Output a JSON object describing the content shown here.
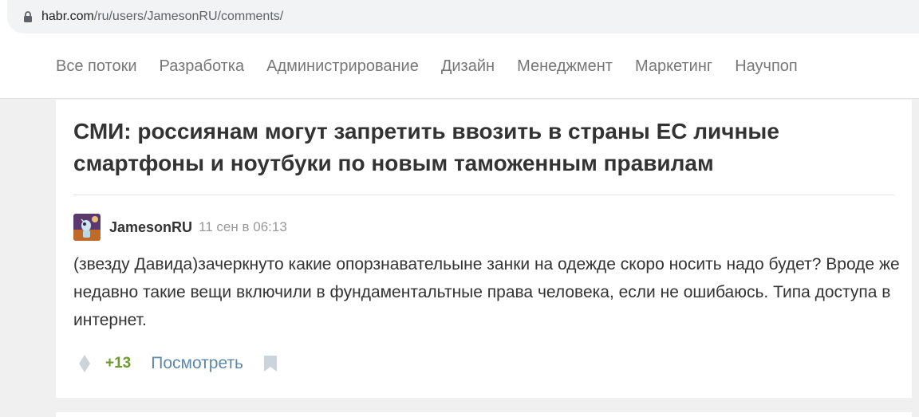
{
  "browser": {
    "url_host": "habr.com",
    "url_path": "/ru/users/JamesonRU/comments/"
  },
  "nav": {
    "items": [
      {
        "label": "Все потоки"
      },
      {
        "label": "Разработка"
      },
      {
        "label": "Администрирование"
      },
      {
        "label": "Дизайн"
      },
      {
        "label": "Менеджмент"
      },
      {
        "label": "Маркетинг"
      },
      {
        "label": "Научпоп"
      }
    ]
  },
  "article": {
    "title": "СМИ: россиянам могут запретить ввозить в страны ЕС личные смартфоны и ноутбуки по новым таможенным правилам"
  },
  "comment": {
    "author": "JamesonRU",
    "time": "11 сен в 06:13",
    "text": "(звезду Давида)зачеркнуто какие опорзнавательыне занки на одежде скоро носить надо будет? Вроде же недавно такие вещи включили в фундаментальтные права человека, если не ошибаюсь. Типа доступа в интернет.",
    "score": "+13",
    "view_label": "Посмотреть"
  },
  "icons": {
    "lock": "lock-icon",
    "vote": "vote-diamond-icon",
    "bookmark": "bookmark-icon",
    "avatar": "alien-avatar"
  },
  "colors": {
    "score": "#6e9a2f",
    "link": "#5e87a8"
  }
}
